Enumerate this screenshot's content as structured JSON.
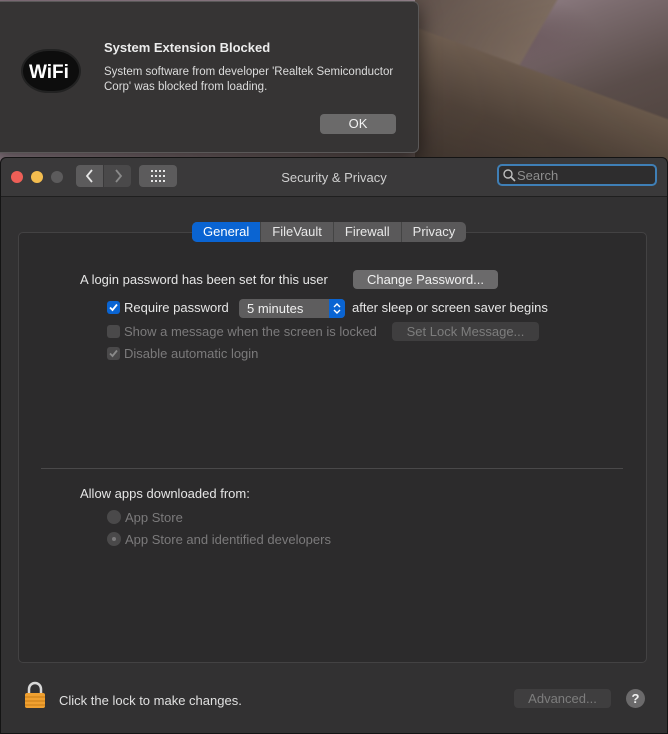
{
  "alert": {
    "title": "System Extension Blocked",
    "message": "System software from developer 'Realtek Semiconductor Corp' was blocked from loading.",
    "ok_label": "OK",
    "logo_text": "WiFi"
  },
  "window": {
    "title": "Security & Privacy",
    "search_placeholder": "Search"
  },
  "tabs": [
    {
      "label": "General",
      "active": true
    },
    {
      "label": "FileVault",
      "active": false
    },
    {
      "label": "Firewall",
      "active": false
    },
    {
      "label": "Privacy",
      "active": false
    }
  ],
  "general": {
    "login_text": "A login password has been set for this user",
    "change_password_label": "Change Password...",
    "require_password_label": "Require password",
    "require_password_checked": true,
    "require_password_delay": "5 minutes",
    "after_sleep_text": "after sleep or screen saver begins",
    "show_message_label": "Show a message when the screen is locked",
    "show_message_checked": false,
    "set_lock_message_label": "Set Lock Message...",
    "disable_autologin_label": "Disable automatic login",
    "disable_autologin_checked": true,
    "allow_apps_label": "Allow apps downloaded from:",
    "app_store_label": "App Store",
    "app_store_identified_label": "App Store and identified developers",
    "selected_source": "App Store and identified developers"
  },
  "footer": {
    "lock_text": "Click the lock to make changes.",
    "advanced_label": "Advanced...",
    "help_label": "?"
  },
  "colors": {
    "accent": "#0a64d2",
    "close": "#ee5f57",
    "minimize": "#f4bd4f",
    "lock": "#f0a030"
  }
}
